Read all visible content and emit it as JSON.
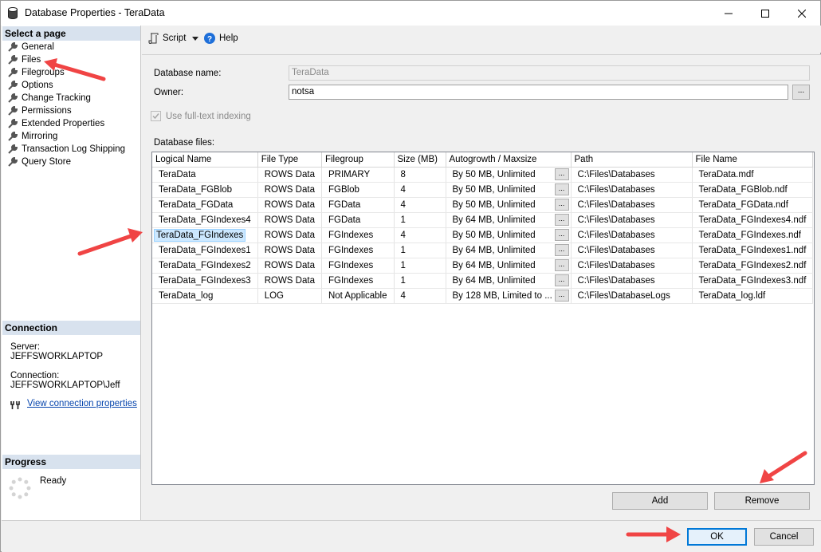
{
  "window": {
    "title": "Database Properties - TeraData"
  },
  "sidebar": {
    "select_header": "Select a page",
    "items": [
      {
        "label": "General"
      },
      {
        "label": "Files"
      },
      {
        "label": "Filegroups"
      },
      {
        "label": "Options"
      },
      {
        "label": "Change Tracking"
      },
      {
        "label": "Permissions"
      },
      {
        "label": "Extended Properties"
      },
      {
        "label": "Mirroring"
      },
      {
        "label": "Transaction Log Shipping"
      },
      {
        "label": "Query Store"
      }
    ],
    "connection_header": "Connection",
    "server_label": "Server:",
    "server_value": "JEFFSWORKLAPTOP",
    "connection_label": "Connection:",
    "connection_value": "JEFFSWORKLAPTOP\\Jeff",
    "view_link": "View connection properties",
    "progress_header": "Progress",
    "progress_status": "Ready"
  },
  "toolbar": {
    "script_label": "Script",
    "help_label": "Help"
  },
  "form": {
    "db_name_label": "Database name:",
    "db_name_value": "TeraData",
    "owner_label": "Owner:",
    "owner_value": "notsa",
    "fulltext_label": "Use full-text indexing",
    "db_files_label": "Database files:"
  },
  "table": {
    "headers": [
      "Logical Name",
      "File Type",
      "Filegroup",
      "Size (MB)",
      "Autogrowth / Maxsize",
      "Path",
      "File Name"
    ],
    "rows": [
      [
        "TeraData",
        "ROWS Data",
        "PRIMARY",
        "8",
        "By 50 MB, Unlimited",
        "C:\\Files\\Databases",
        "TeraData.mdf"
      ],
      [
        "TeraData_FGBlob",
        "ROWS Data",
        "FGBlob",
        "4",
        "By 50 MB, Unlimited",
        "C:\\Files\\Databases",
        "TeraData_FGBlob.ndf"
      ],
      [
        "TeraData_FGData",
        "ROWS Data",
        "FGData",
        "4",
        "By 50 MB, Unlimited",
        "C:\\Files\\Databases",
        "TeraData_FGData.ndf"
      ],
      [
        "TeraData_FGIndexes4",
        "ROWS Data",
        "FGData",
        "1",
        "By 64 MB, Unlimited",
        "C:\\Files\\Databases",
        "TeraData_FGIndexes4.ndf"
      ],
      [
        "TeraData_FGIndexes",
        "ROWS Data",
        "FGIndexes",
        "4",
        "By 50 MB, Unlimited",
        "C:\\Files\\Databases",
        "TeraData_FGIndexes.ndf"
      ],
      [
        "TeraData_FGIndexes1",
        "ROWS Data",
        "FGIndexes",
        "1",
        "By 64 MB, Unlimited",
        "C:\\Files\\Databases",
        "TeraData_FGIndexes1.ndf"
      ],
      [
        "TeraData_FGIndexes2",
        "ROWS Data",
        "FGIndexes",
        "1",
        "By 64 MB, Unlimited",
        "C:\\Files\\Databases",
        "TeraData_FGIndexes2.ndf"
      ],
      [
        "TeraData_FGIndexes3",
        "ROWS Data",
        "FGIndexes",
        "1",
        "By 64 MB, Unlimited",
        "C:\\Files\\Databases",
        "TeraData_FGIndexes3.ndf"
      ],
      [
        "TeraData_log",
        "LOG",
        "Not Applicable",
        "4",
        "By 128 MB, Limited to ...",
        "C:\\Files\\DatabaseLogs",
        "TeraData_log.ldf"
      ]
    ],
    "ellipsis": "...",
    "selected_row": 4
  },
  "buttons": {
    "add": "Add",
    "remove": "Remove",
    "ok": "OK",
    "cancel": "Cancel",
    "owner_browse": "..."
  },
  "colors": {
    "arrow": "#f04444",
    "header_bg": "#d8e2ee",
    "selection": "#cce8ff",
    "link": "#0645ad",
    "default_button": "#0078d7"
  }
}
